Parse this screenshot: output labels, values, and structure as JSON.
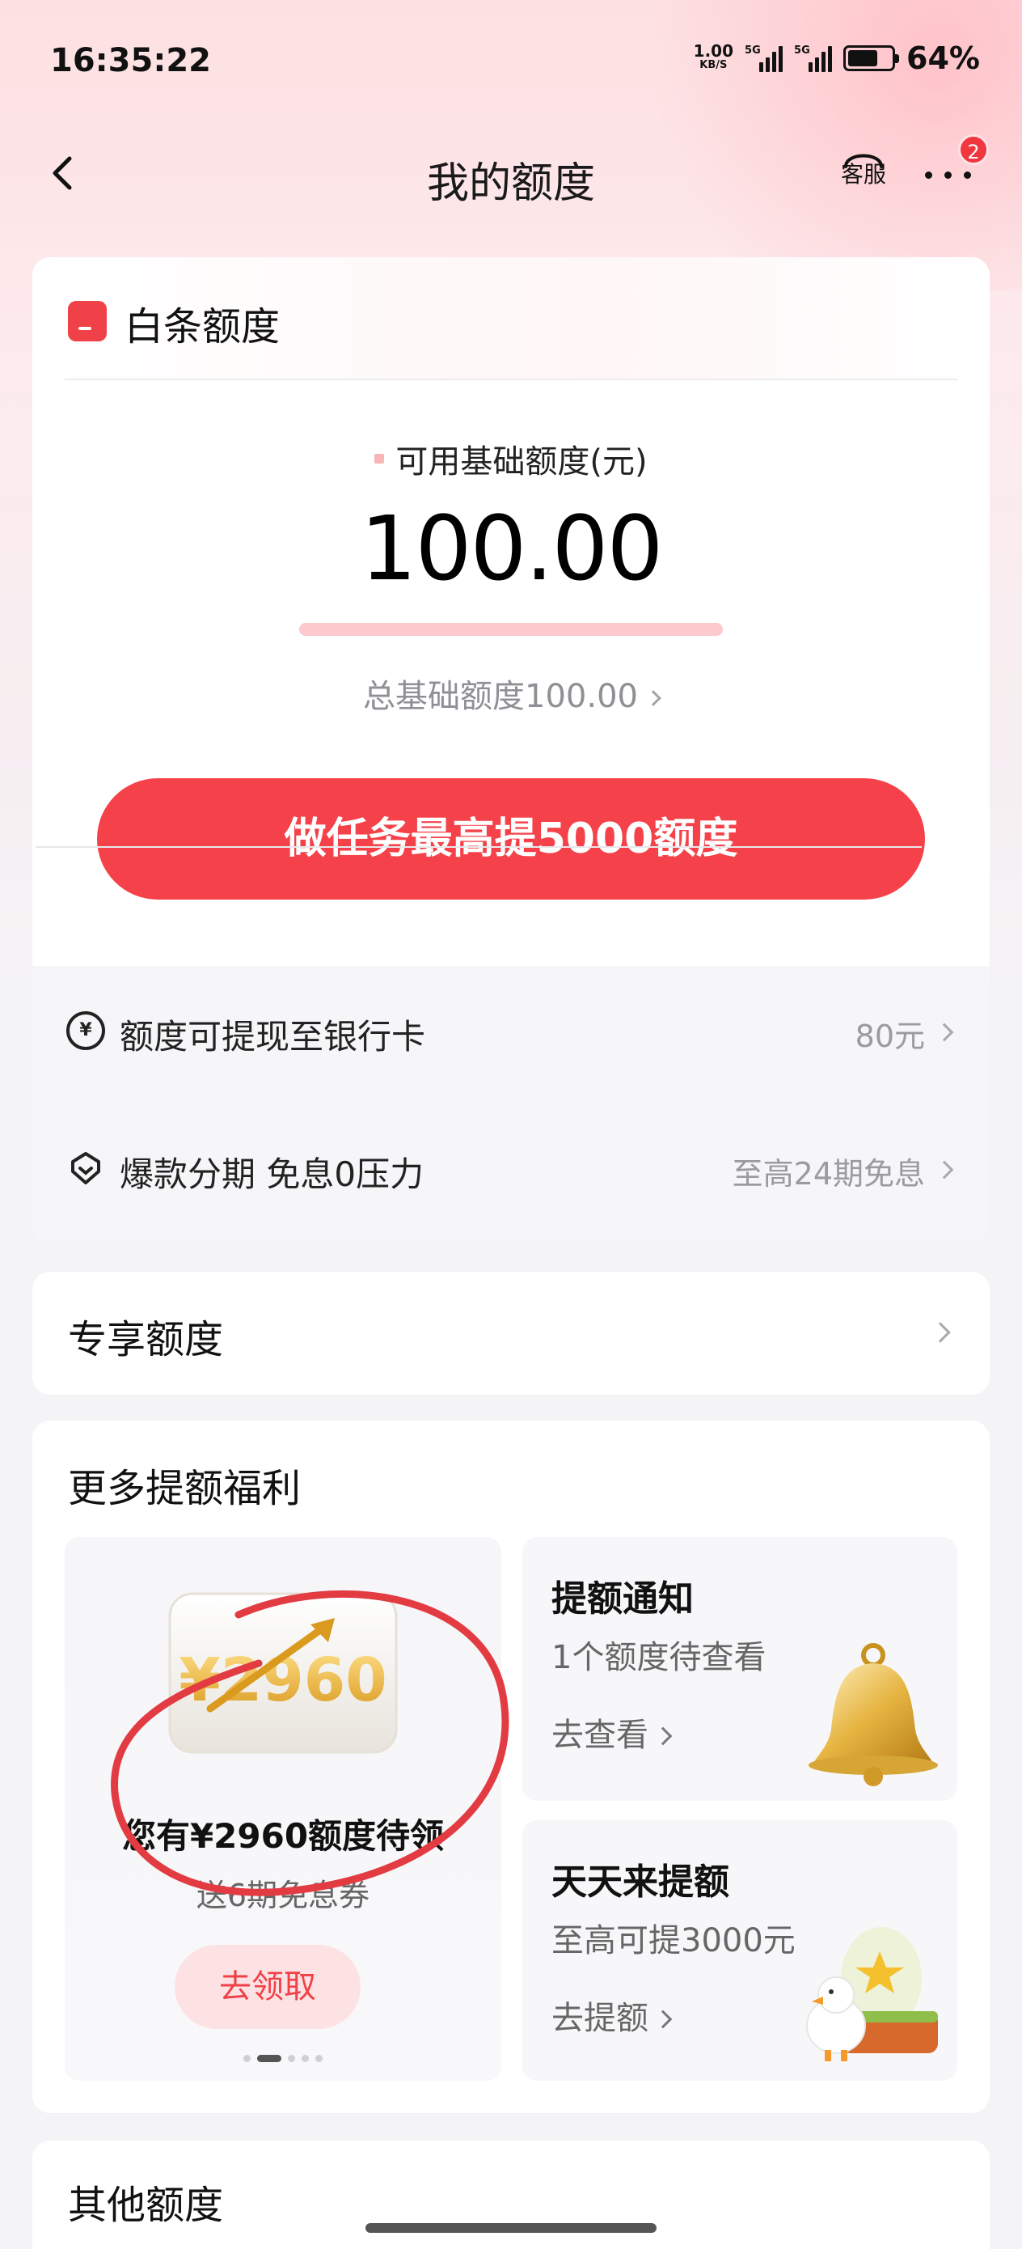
{
  "status_bar": {
    "time": "16:35:22",
    "net_speed": "1.00",
    "net_speed_unit": "KB/S",
    "sim1": "5G",
    "sim2": "5G",
    "battery": "64%"
  },
  "nav": {
    "title": "我的额度",
    "service_label": "客服",
    "more_badge": "2"
  },
  "baitiao": {
    "title": "白条额度",
    "available_label": "可用基础额度(元)",
    "available_amount": "100.00",
    "total_label": "总基础额度100.00",
    "task_button": "做任务最高提5000额度",
    "rows": [
      {
        "icon": "yen-coin-icon",
        "label": "额度可提现至银行卡",
        "value": "80元"
      },
      {
        "icon": "shopping-tag-icon",
        "label": "爆款分期 免息0压力",
        "value": "至高24期免息"
      }
    ]
  },
  "exclusive": {
    "title": "专享额度"
  },
  "benefits": {
    "title": "更多提额福利",
    "promo": {
      "art_text": "¥2960",
      "main": "您有¥2960额度待领",
      "sub": "送6期免息券",
      "button": "去领取",
      "pages": 5,
      "active_page": 2
    },
    "tiles": [
      {
        "title": "提额通知",
        "subtitle": "1个额度待查看",
        "action": "去查看",
        "icon": "gold-bell-icon"
      },
      {
        "title": "天天来提额",
        "subtitle": "至高可提3000元",
        "action": "去提额",
        "icon": "duck-egg-icon"
      }
    ]
  },
  "other": {
    "title": "其他额度"
  },
  "colors": {
    "brand_red": "#f5424a",
    "annotation_red": "#e23b42"
  }
}
